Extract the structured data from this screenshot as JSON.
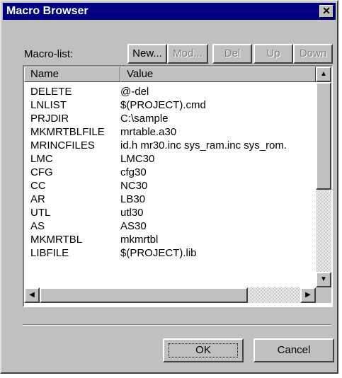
{
  "window": {
    "title": "Macro Browser",
    "close_label": "✕"
  },
  "toolbar": {
    "list_label": "Macro-list:",
    "new_label": "New...",
    "modify_label": "Mod...",
    "delete_label": "Del",
    "up_label": "Up",
    "down_label": "Down"
  },
  "table": {
    "columns": [
      "Name",
      "Value"
    ],
    "rows": [
      {
        "name": "DELETE",
        "value": "@-del"
      },
      {
        "name": "LNLIST",
        "value": "$(PROJECT).cmd"
      },
      {
        "name": "PRJDIR",
        "value": "C:\\sample"
      },
      {
        "name": "MKMRTBLFILE",
        "value": "mrtable.a30"
      },
      {
        "name": "MRINCFILES",
        "value": "id.h mr30.inc sys_ram.inc sys_rom."
      },
      {
        "name": "LMC",
        "value": "LMC30"
      },
      {
        "name": "CFG",
        "value": "cfg30"
      },
      {
        "name": "CC",
        "value": "NC30"
      },
      {
        "name": "AR",
        "value": "LB30"
      },
      {
        "name": "UTL",
        "value": "utl30"
      },
      {
        "name": "AS",
        "value": "AS30"
      },
      {
        "name": "MKMRTBL",
        "value": "mkmrtbl"
      },
      {
        "name": "LIBFILE",
        "value": "$(PROJECT).lib"
      }
    ]
  },
  "scroll": {
    "up": "▲",
    "down": "▼",
    "left": "◀",
    "right": "▶"
  },
  "footer": {
    "ok_label": "OK",
    "cancel_label": "Cancel"
  }
}
